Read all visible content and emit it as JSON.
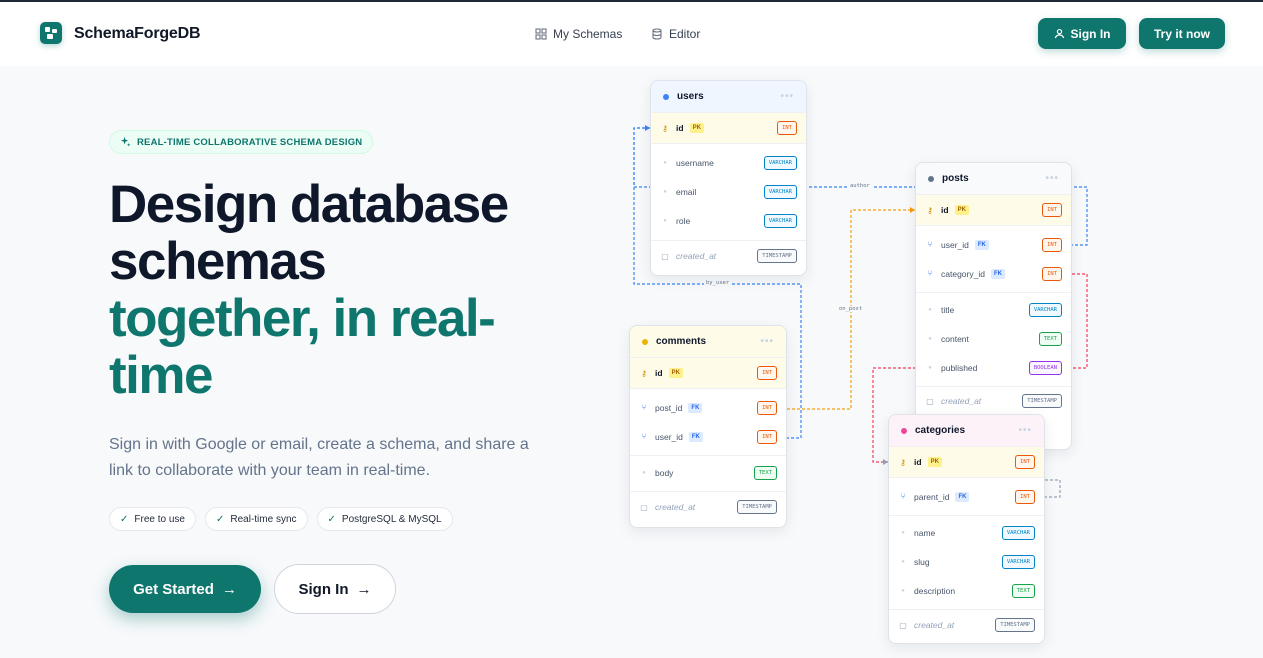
{
  "header": {
    "brand": "SchemaForgeDB",
    "nav": [
      {
        "label": "My Schemas",
        "icon": "grid-icon"
      },
      {
        "label": "Editor",
        "icon": "database-icon"
      }
    ],
    "sign_in": "Sign In",
    "try_now": "Try it now"
  },
  "hero": {
    "badge": "REAL-TIME COLLABORATIVE SCHEMA DESIGN",
    "title_line1": "Design database",
    "title_line2": "schemas",
    "title_line3": "together, in real-",
    "title_line4": "time",
    "subtitle": "Sign in with Google or email, create a schema, and share a link to collaborate with your team in real-time.",
    "chips": [
      "Free to use",
      "Real-time sync",
      "PostgreSQL & MySQL"
    ],
    "cta_primary": "Get Started",
    "cta_secondary": "Sign In",
    "accent": "#0f766e"
  },
  "diagram": {
    "relations": [
      "author",
      "by_user",
      "on_post"
    ],
    "tables": {
      "users": {
        "name": "users",
        "color": "#3b82f6",
        "cols": [
          {
            "name": "id",
            "tag": "PK",
            "type": "INT"
          },
          {
            "name": "username",
            "type": "VARCHAR"
          },
          {
            "name": "email",
            "type": "VARCHAR"
          },
          {
            "name": "role",
            "type": "VARCHAR"
          },
          {
            "name": "created_at",
            "type": "TIMESTAMP"
          }
        ]
      },
      "posts": {
        "name": "posts",
        "color": "#64748b",
        "cols": [
          {
            "name": "id",
            "tag": "PK",
            "type": "INT"
          },
          {
            "name": "user_id",
            "tag": "FK",
            "type": "INT"
          },
          {
            "name": "category_id",
            "tag": "FK",
            "type": "INT"
          },
          {
            "name": "title",
            "type": "VARCHAR"
          },
          {
            "name": "content",
            "type": "TEXT"
          },
          {
            "name": "published",
            "type": "BOOLEAN"
          },
          {
            "name": "created_at",
            "type": "TIMESTAMP"
          }
        ]
      },
      "comments": {
        "name": "comments",
        "color": "#eab308",
        "cols": [
          {
            "name": "id",
            "tag": "PK",
            "type": "INT"
          },
          {
            "name": "post_id",
            "tag": "FK",
            "type": "INT"
          },
          {
            "name": "user_id",
            "tag": "FK",
            "type": "INT"
          },
          {
            "name": "body",
            "type": "TEXT"
          },
          {
            "name": "created_at",
            "type": "TIMESTAMP"
          }
        ]
      },
      "categories": {
        "name": "categories",
        "color": "#ec4899",
        "cols": [
          {
            "name": "id",
            "tag": "PK",
            "type": "INT"
          },
          {
            "name": "parent_id",
            "tag": "FK",
            "type": "INT"
          },
          {
            "name": "name",
            "type": "VARCHAR"
          },
          {
            "name": "slug",
            "type": "VARCHAR"
          },
          {
            "name": "description",
            "type": "TEXT"
          },
          {
            "name": "created_at",
            "type": "TIMESTAMP"
          }
        ]
      }
    }
  }
}
